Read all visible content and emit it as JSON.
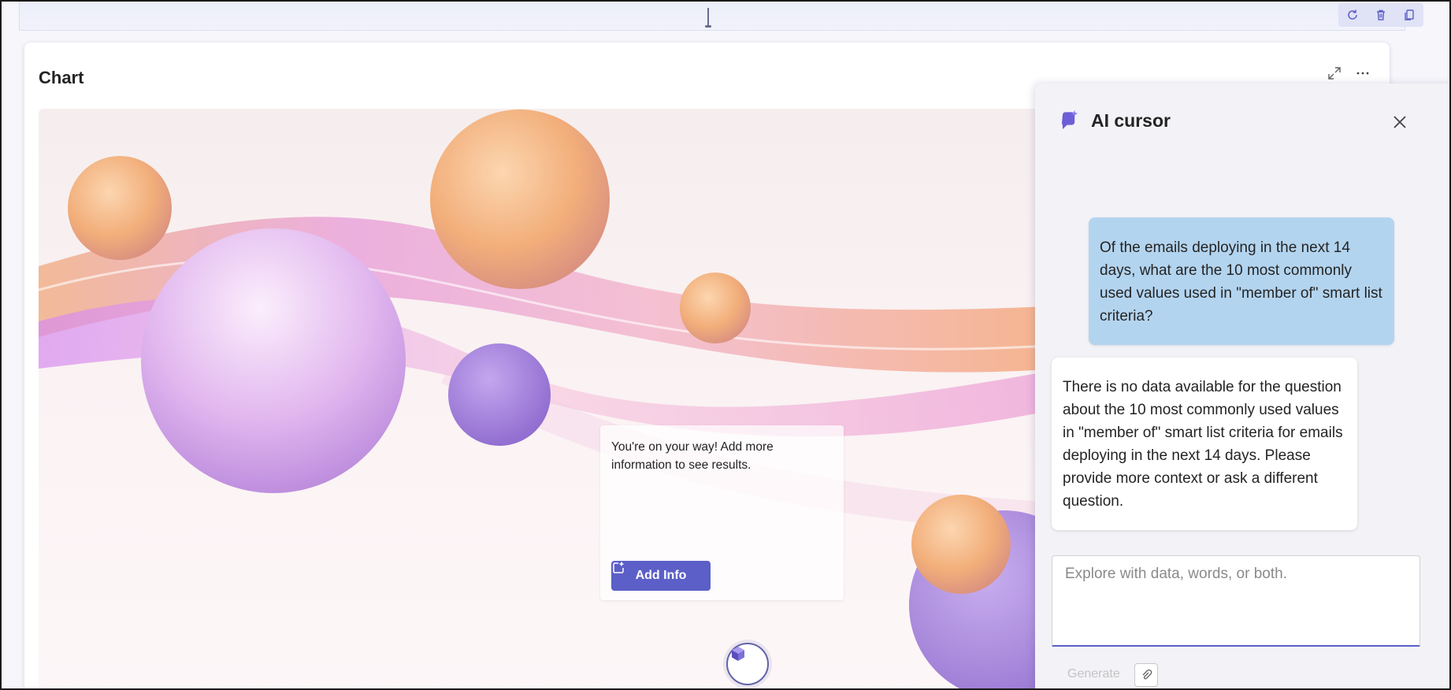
{
  "toolbar": {
    "icons": [
      "refresh-icon",
      "delete-icon",
      "copy-icon"
    ]
  },
  "card": {
    "title": "Chart",
    "actions": [
      "expand-icon",
      "more-icon"
    ]
  },
  "canvas": {
    "hint_text": "You're on your way! Add more information to see results.",
    "add_info_label": "Add Info"
  },
  "panel": {
    "title": "AI cursor",
    "user_message": "Of the emails deploying in the next 14 days, what are the 10 most commonly used values used in \"member of\" smart list criteria?",
    "bot_message": "There is no data available for the question about the 10 most commonly used values in \"member of\" smart list criteria for emails deploying in the next 14 days. Please provide more context or ask a different question.",
    "input_placeholder": "Explore with data, words, or both.",
    "input_value": "",
    "generate_label": "Generate"
  },
  "colors": {
    "accent": "#5b5fc7",
    "user_bubble": "#b3d4ef",
    "panel_bg": "#f3f3f7"
  }
}
